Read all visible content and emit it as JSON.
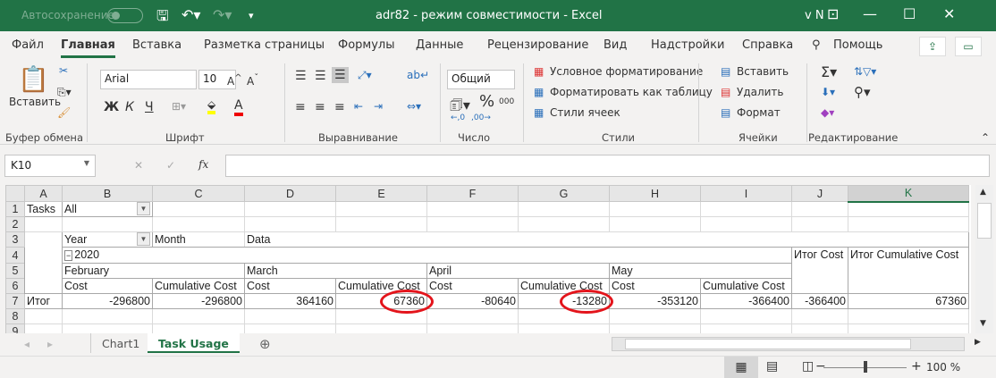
{
  "titlebar": {
    "autosave": "Автосохранение",
    "title": "adr82  -  режим совместимости  -  Excel",
    "user": "v N"
  },
  "ribbon_tabs": [
    "Файл",
    "Главная",
    "Вставка",
    "Разметка страницы",
    "Формулы",
    "Данные",
    "Рецензирование",
    "Вид",
    "Надстройки",
    "Справка",
    "Помощь"
  ],
  "clipboard": {
    "paste": "Вставить",
    "label": "Буфер обмена"
  },
  "font": {
    "name": "Arial",
    "size": "10",
    "bold": "Ж",
    "italic": "К",
    "underline": "Ч",
    "label": "Шрифт"
  },
  "alignment": {
    "label": "Выравнивание"
  },
  "number": {
    "format": "Общий",
    "label": "Число"
  },
  "styles": {
    "conditional": "Условное форматирование",
    "as_table": "Форматировать как таблицу",
    "cell_styles": "Стили ячеек",
    "label": "Стили"
  },
  "cells": {
    "insert": "Вставить",
    "delete": "Удалить",
    "format": "Формат",
    "label": "Ячейки"
  },
  "editing": {
    "label": "Редактирование"
  },
  "formula_bar": {
    "name_box": "K10",
    "value": ""
  },
  "columns": [
    "A",
    "B",
    "C",
    "D",
    "E",
    "F",
    "G",
    "H",
    "I",
    "J",
    "K"
  ],
  "rows": [
    "1",
    "2",
    "3",
    "4",
    "5",
    "6",
    "7",
    "8",
    "9"
  ],
  "pivot": {
    "filter_label": "Tasks",
    "filter_value": "All",
    "year": "Year",
    "month": "Month",
    "data": "Data",
    "year_value": "2020",
    "months": [
      "February",
      "March",
      "April",
      "May"
    ],
    "cost": "Cost",
    "cum_cost": "Cumulative Cost",
    "total_cost": "Итог Cost",
    "total_cum_cost": "Итог Cumulative Cost",
    "row_label": "Итог",
    "values": [
      "-296800",
      "-296800",
      "364160",
      "67360",
      "-80640",
      "-13280",
      "-353120",
      "-366400",
      "-366400",
      "67360"
    ]
  },
  "sheets": [
    "Chart1",
    "Task Usage"
  ],
  "status": {
    "zoom": "100 %"
  }
}
